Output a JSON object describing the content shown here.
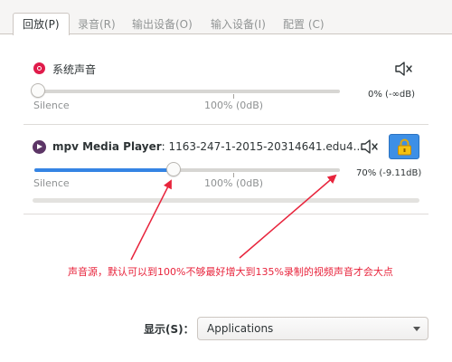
{
  "tabs": [
    {
      "label": "回放(P)",
      "active": true
    },
    {
      "label": "录音(R)",
      "active": false
    },
    {
      "label": "输出设备(O)",
      "active": false
    },
    {
      "label": "输入设备(I)",
      "active": false
    },
    {
      "label": "配置 (C)",
      "active": false
    }
  ],
  "system_stream": {
    "title": "系统声音",
    "level_text": "0% (-∞dB)",
    "silence_label": "Silence",
    "reference_label": "100% (0dB)",
    "volume_percent": 0,
    "icon_color": "#e01b4a"
  },
  "mpv_stream": {
    "app_name": "mpv Media Player",
    "media_title": ": 1163-247-1-2015-20314641.edu4.…",
    "level_text": "70% (-9.11dB)",
    "silence_label": "Silence",
    "reference_label": "100% (0dB)",
    "volume_percent": 70,
    "icon_color": "#5c3566"
  },
  "annotation": {
    "text": "声音源，默认可以到100%不够最好增大到135%录制的视频声音才会大点",
    "color": "#e8243c"
  },
  "footer": {
    "show_label": "显示(S)：",
    "selected_option": "Applications"
  },
  "icons": {
    "mute": "speaker-muted-icon",
    "lock": "lock-icon",
    "dropdown": "chevron-down-icon"
  },
  "colors": {
    "accent": "#3584e4",
    "lock_button": "#3d8fe6",
    "lock_glyph": "#f5c211"
  }
}
